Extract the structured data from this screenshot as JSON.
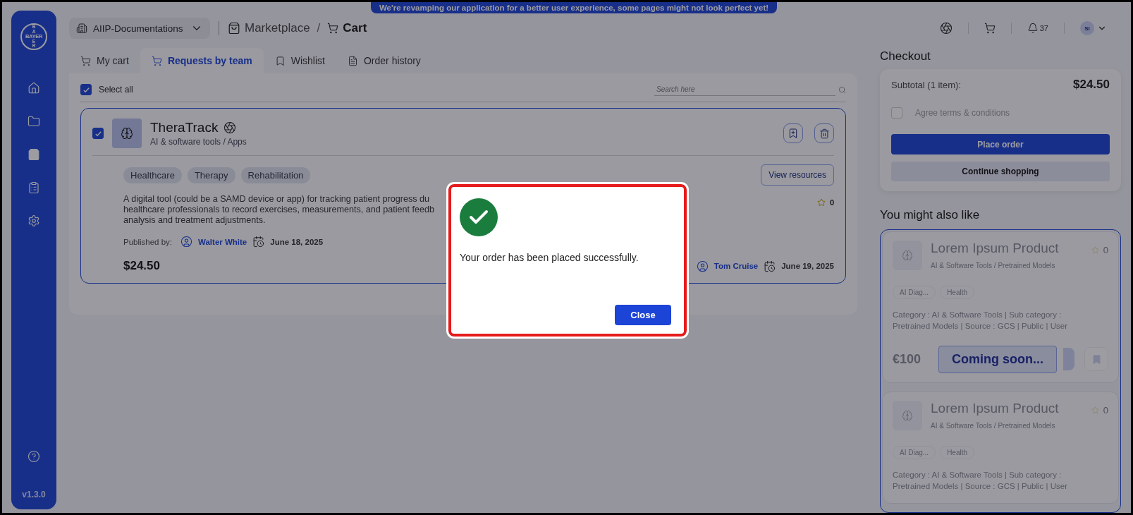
{
  "banner": {
    "text": "We're revamping our application for a better user experience, some pages might not look perfect yet!"
  },
  "logo": {
    "horizontal": "BAYER",
    "vertical_top": "BA",
    "vertical_bottom": "ER"
  },
  "sidebar": {
    "items": [
      {
        "selected": false
      },
      {
        "selected": false
      },
      {
        "selected": true
      },
      {
        "selected": false
      },
      {
        "selected": false
      }
    ],
    "version": "v1.3.0"
  },
  "header": {
    "workspace": "AIIP-Documentations",
    "breadcrumb": [
      {
        "label": "Marketplace",
        "current": false
      },
      {
        "label": "Cart",
        "current": true
      }
    ],
    "separator": "/",
    "notifications": "37",
    "avatar": "SI"
  },
  "tabs": [
    {
      "label": "My cart",
      "selected": false
    },
    {
      "label": "Requests by team",
      "selected": true
    },
    {
      "label": "Wishlist",
      "selected": false
    },
    {
      "label": "Order history",
      "selected": false
    }
  ],
  "cart": {
    "select_all": {
      "label": "Select all",
      "checked": true
    },
    "search": {
      "placeholder": "Search here"
    },
    "items": [
      {
        "checked": true,
        "title": "TheraTrack",
        "category": "AI & software tools / Apps",
        "tags": [
          "Healthcare",
          "Therapy",
          "Rehabilitation"
        ],
        "description": [
          "A digital tool (could be a SAMD device or app) for tracking patient progress du",
          "healthcare professionals to record exercises, measurements, and patient feedb",
          "analysis and treatment adjustments."
        ],
        "published_label": "Published by:",
        "publisher": "Walter White",
        "published_date": "June 18, 2025",
        "price": "$24.50",
        "rating": "0",
        "view_button": "View resources",
        "requester": "Tom Cruise",
        "requested_date": "June 19, 2025"
      }
    ]
  },
  "checkout": {
    "title": "Checkout",
    "subtotal_label": "Subtotal (1 item):",
    "subtotal": "$24.50",
    "terms": {
      "label": "Agree terms & conditions",
      "checked": false
    },
    "place_order": "Place order",
    "continue": "Continue shopping"
  },
  "recommendations": {
    "title": "You might also like",
    "coming_soon": "Coming soon...",
    "cards": [
      {
        "title": "Lorem Ipsum Product",
        "category": "AI & Software Tools / Pretrained Models",
        "rating": "0",
        "tags": [
          "AI Diag...",
          "Health"
        ],
        "description": "Category : AI & Software Tools | Sub category : Pretrained Models | Source : GCS | Public | User",
        "price": "€100"
      },
      {
        "title": "Lorem Ipsum Product",
        "category": "AI & Software Tools / Pretrained Models",
        "rating": "0",
        "tags": [
          "AI Diag...",
          "Health"
        ],
        "description": "Category : AI & Software Tools | Sub category : Pretrained Models | Source : GCS | Public | User"
      }
    ]
  },
  "dialog": {
    "message": "Your order has been placed successfully.",
    "button": "Close"
  }
}
